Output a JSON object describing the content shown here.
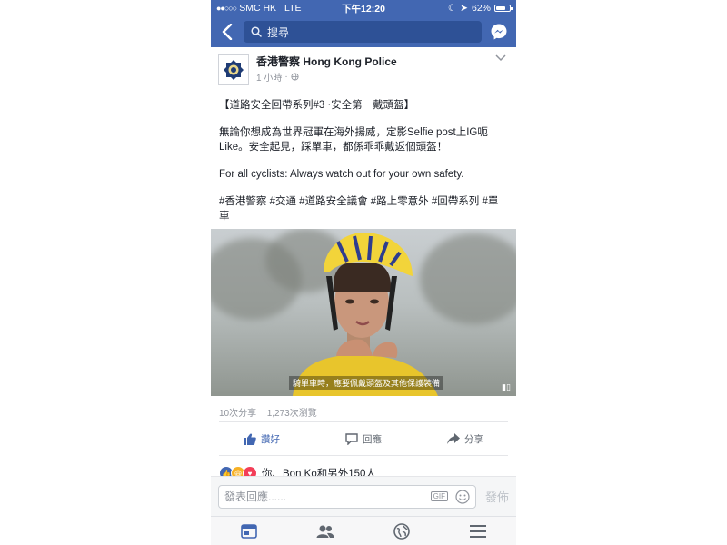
{
  "status_bar": {
    "carrier": "SMC HK",
    "network": "LTE",
    "time": "下午12:20",
    "battery": "62%",
    "battery_level": 0.62
  },
  "search": {
    "placeholder": "搜尋"
  },
  "post": {
    "author": "香港警察 Hong Kong Police",
    "timestamp": "1 小時",
    "paragraphs": [
      "【道路安全回帶系列#3 ‧安全第一戴頭盔】",
      "無論你想成為世界冠軍在海外揚威，定影Selfie post上IG呃Like。安全起見，踩單車，都係乖乖戴返個頭盔！",
      "For all cyclists: Always watch out for your own safety."
    ],
    "hashtags": "#香港警察 #交通 #道路安全議會 #路上零意外 #回帶系列 #單車",
    "video_caption": "騎單車時，應要佩戴頭盔及其他保護裝備",
    "stats": {
      "shares": "10次分享",
      "views": "1,273次瀏覽"
    },
    "actions": {
      "like": "讚好",
      "comment": "回應",
      "share": "分享"
    },
    "reactions_text": "你、Bon Ko和另外150人"
  },
  "comment_bar": {
    "placeholder": "發表回應......",
    "gif": "GIF",
    "send": "發佈"
  },
  "colors": {
    "brand": "#4267b2",
    "like": "#4267b2",
    "muted": "#90949c"
  }
}
